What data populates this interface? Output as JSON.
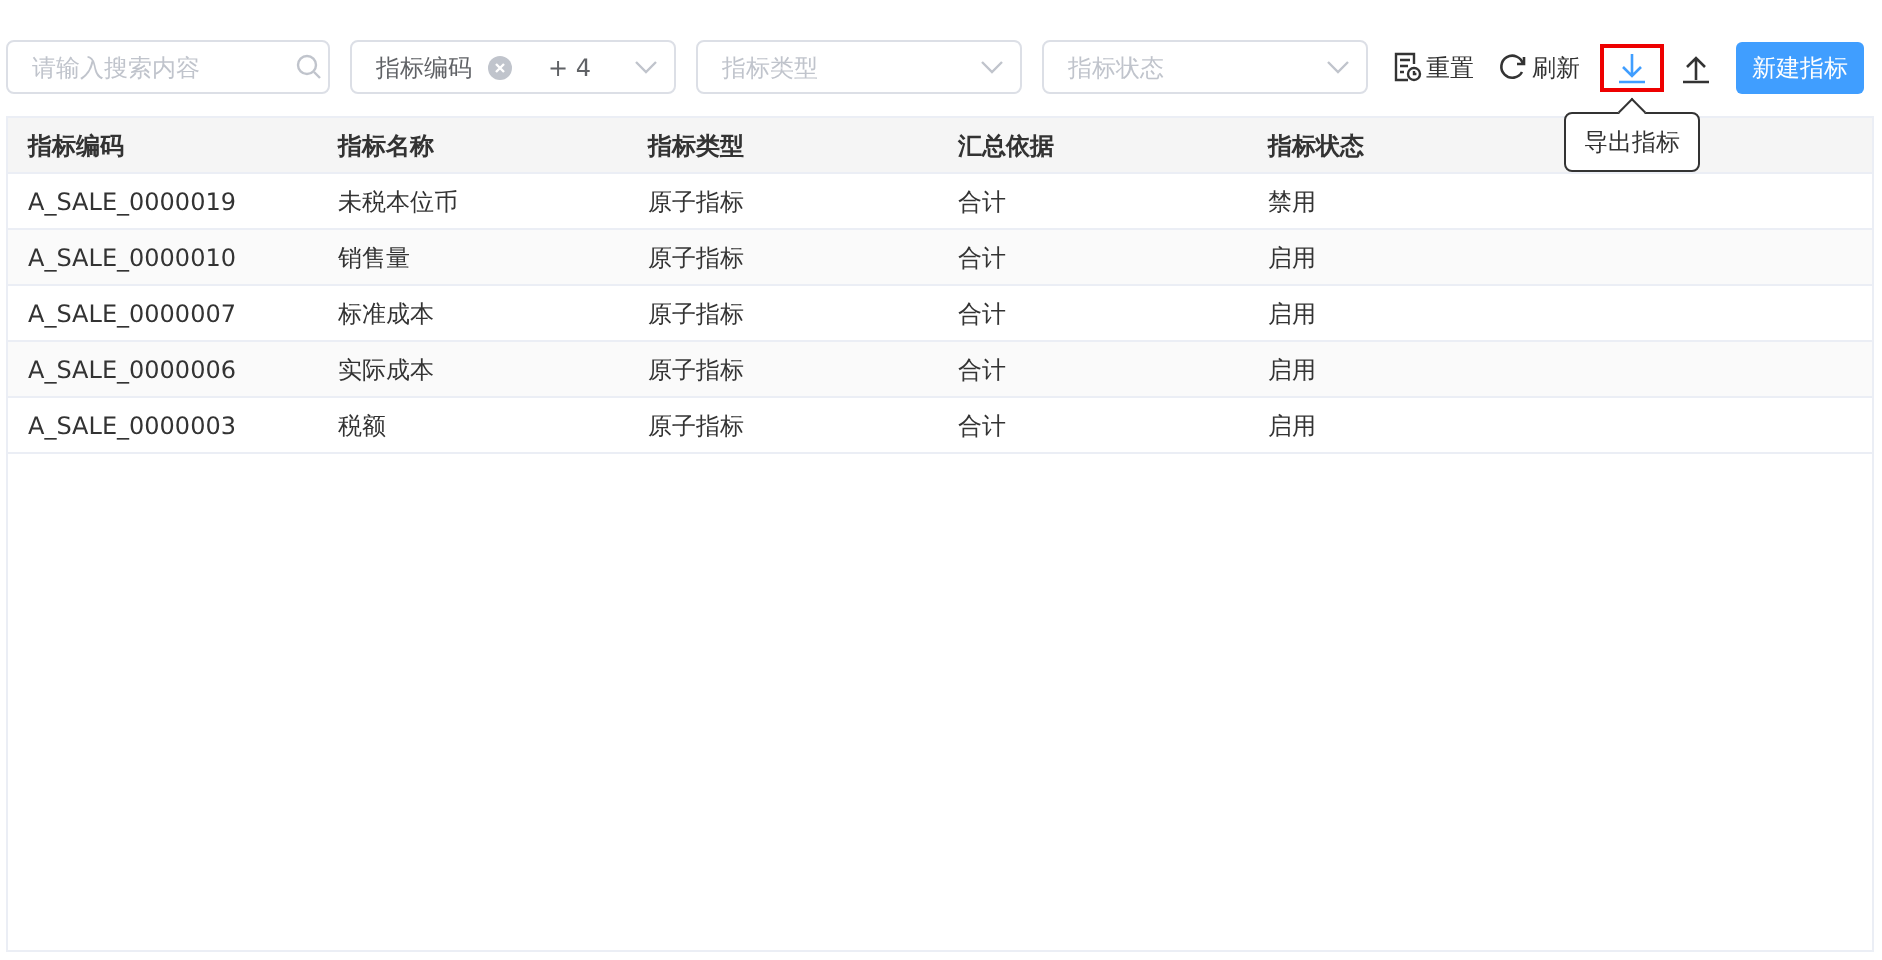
{
  "search": {
    "placeholder": "请输入搜索内容"
  },
  "filters": [
    {
      "kind": "tags",
      "tag": "指标编码",
      "more": "+ 4"
    },
    {
      "kind": "empty",
      "placeholder": "指标类型"
    },
    {
      "kind": "empty",
      "placeholder": "指标状态"
    }
  ],
  "toolbar": [
    {
      "kind": "reset",
      "label": "重置",
      "highlighted": false
    },
    {
      "kind": "refresh",
      "label": "刷新",
      "highlighted": false
    },
    {
      "kind": "download",
      "highlighted": true
    },
    {
      "kind": "upload",
      "highlighted": false
    }
  ],
  "tooltip": "导出指标",
  "primary_button": "新建指标",
  "table": {
    "columns": [
      "指标编码",
      "指标名称",
      "指标类型",
      "汇总依据",
      "指标状态"
    ],
    "rows": [
      [
        "A_SALE_0000019",
        "未税本位币",
        "原子指标",
        "合计",
        "禁用"
      ],
      [
        "A_SALE_0000010",
        "销售量",
        "原子指标",
        "合计",
        "启用"
      ],
      [
        "A_SALE_0000007",
        "标准成本",
        "原子指标",
        "合计",
        "启用"
      ],
      [
        "A_SALE_0000006",
        "实际成本",
        "原子指标",
        "合计",
        "启用"
      ],
      [
        "A_SALE_0000003",
        "税额",
        "原子指标",
        "合计",
        "启用"
      ]
    ]
  }
}
